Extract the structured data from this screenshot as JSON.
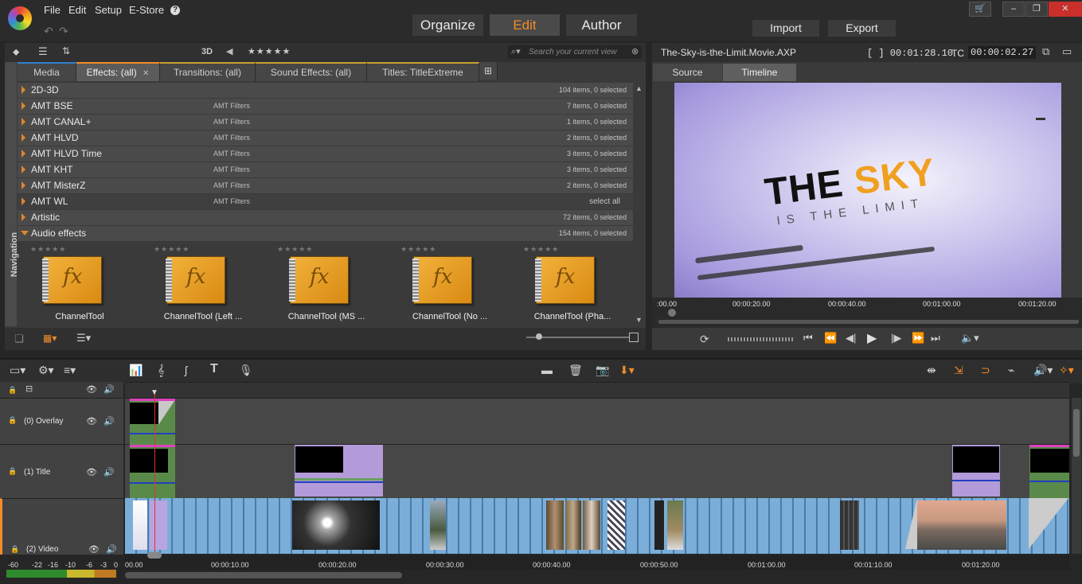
{
  "menu": {
    "items": [
      "File",
      "Edit",
      "Setup",
      "E-Store",
      "?"
    ]
  },
  "modes": [
    {
      "label": "Organize",
      "active": false
    },
    {
      "label": "Edit",
      "active": true
    },
    {
      "label": "Author",
      "active": false
    }
  ],
  "top_buttons": {
    "import": "Import",
    "export": "Export"
  },
  "library": {
    "toolbar": {
      "three_d": "3D",
      "rating": "★★★★★",
      "search_placeholder": "Search your current view"
    },
    "nav_label": "Navigation",
    "tabs": [
      {
        "label": "Media"
      },
      {
        "label": "Effects: (all)",
        "active": true
      },
      {
        "label": "Transitions: (all)"
      },
      {
        "label": "Sound Effects: (all)"
      },
      {
        "label": "Titles: TitleExtreme"
      }
    ],
    "categories": [
      {
        "name": "2D-3D",
        "sub": "",
        "count": "104 items, 0 selected"
      },
      {
        "name": "AMT BSE",
        "sub": "AMT Filters",
        "count": "7 items, 0 selected"
      },
      {
        "name": "AMT CANAL+",
        "sub": "AMT Filters",
        "count": "1 items, 0 selected"
      },
      {
        "name": "AMT HLVD",
        "sub": "AMT Filters",
        "count": "2 items, 0 selected"
      },
      {
        "name": "AMT HLVD Time",
        "sub": "AMT Filters",
        "count": "3 items, 0 selected"
      },
      {
        "name": "AMT KHT",
        "sub": "AMT Filters",
        "count": "3 items, 0 selected"
      },
      {
        "name": "AMT MisterZ",
        "sub": "AMT Filters",
        "count": "2 items, 0 selected"
      },
      {
        "name": "AMT WL",
        "sub": "AMT Filters",
        "count": "select all"
      },
      {
        "name": "Artistic",
        "sub": "",
        "count": "72 items, 0 selected"
      },
      {
        "name": "Audio effects",
        "sub": "",
        "count": "154 items, 0 selected",
        "open": true
      }
    ],
    "effects": [
      {
        "label": "ChannelTool",
        "icon_text": "fx"
      },
      {
        "label": "ChannelTool (Left ...",
        "icon_text": "fx"
      },
      {
        "label": "ChannelTool (MS ...",
        "icon_text": "fx"
      },
      {
        "label": "ChannelTool (No ...",
        "icon_text": "fx"
      },
      {
        "label": "ChannelTool (Pha...",
        "icon_text": "fx"
      }
    ]
  },
  "player": {
    "file": "The-Sky-is-the-Limit.Movie.AXP",
    "duration": "[ ] 00:01:28.10",
    "tc_label": "TC",
    "tc": "00:00:02.27",
    "tabs": [
      {
        "label": "Source"
      },
      {
        "label": "Timeline",
        "active": true
      }
    ],
    "video_title_a": "THE ",
    "video_title_b": "SKY",
    "video_subtitle": "IS THE LIMIT",
    "ruler": [
      ":00.00",
      "00:00:20.00",
      "00:00:40.00",
      "00:01:00.00",
      "00:01:20.00"
    ]
  },
  "timeline": {
    "tracks": [
      {
        "label": "(0) Overlay"
      },
      {
        "label": "(1) Title"
      },
      {
        "label": "(2) Video"
      }
    ],
    "ruler": [
      "00.00",
      "00:00:10.00",
      "00:00:20.00",
      "00:00:30.00",
      "00:00:40.00",
      "00:00:50.00",
      "00:01:00.00",
      "00:01:10.00",
      "00:01:20.00"
    ],
    "meter": [
      "-60",
      "-22",
      "-16",
      "-10",
      "-6",
      "-3",
      "0"
    ]
  },
  "colors": {
    "accent": "#f28c28",
    "clip_green": "#5a8a4a",
    "clip_purple": "#b39ad8",
    "video_blue": "#7aaed9"
  }
}
